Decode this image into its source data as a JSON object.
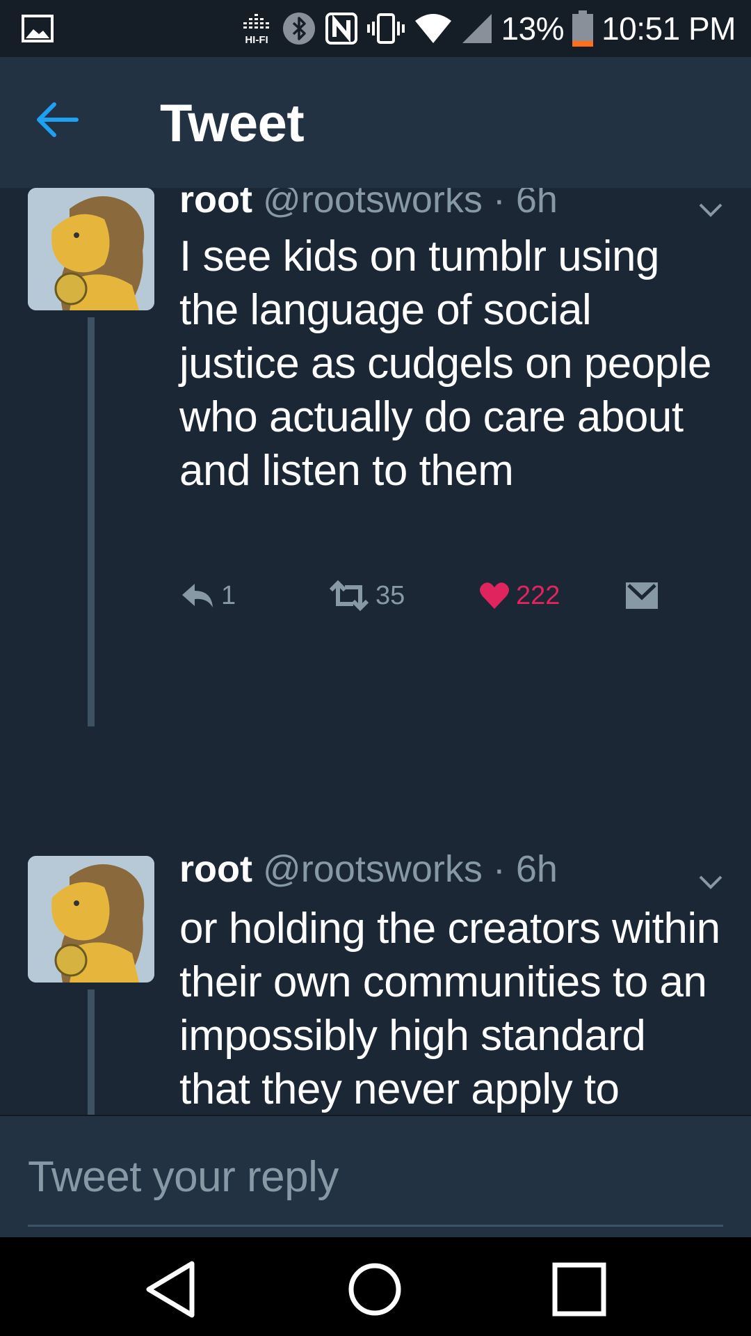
{
  "status_bar": {
    "battery": "13%",
    "time": "10:51 PM",
    "hifi_label": "HI-FI",
    "icons": [
      "gallery-icon",
      "hifi-icon",
      "bluetooth-icon",
      "nfc-icon",
      "vibrate-icon",
      "wifi-icon",
      "cell-signal-icon",
      "battery-icon"
    ],
    "battery_color": "#ff6e1a"
  },
  "header": {
    "title": "Tweet",
    "back_icon": "arrow-left-icon",
    "accent_color": "#1da1f2"
  },
  "tweets": [
    {
      "name": "root",
      "handle": "@rootsworks",
      "separator": "·",
      "time": "6h",
      "text": "I see kids on tumblr using the language of social justice as cudgels on people who actually do care about and listen to them",
      "reply_count": "1",
      "retweet_count": "35",
      "like_count": "222",
      "liked": true
    },
    {
      "name": "root",
      "handle": "@rootsworks",
      "separator": "·",
      "time": "6h",
      "text": "or holding the creators within their own communities to an impossibly high standard that they never apply to mainstream media properties"
    }
  ],
  "reply": {
    "placeholder": "Tweet your reply"
  },
  "colors": {
    "background": "#1b2734",
    "header": "#233242",
    "secondary_text": "#8899a6",
    "like": "#e0245e"
  }
}
